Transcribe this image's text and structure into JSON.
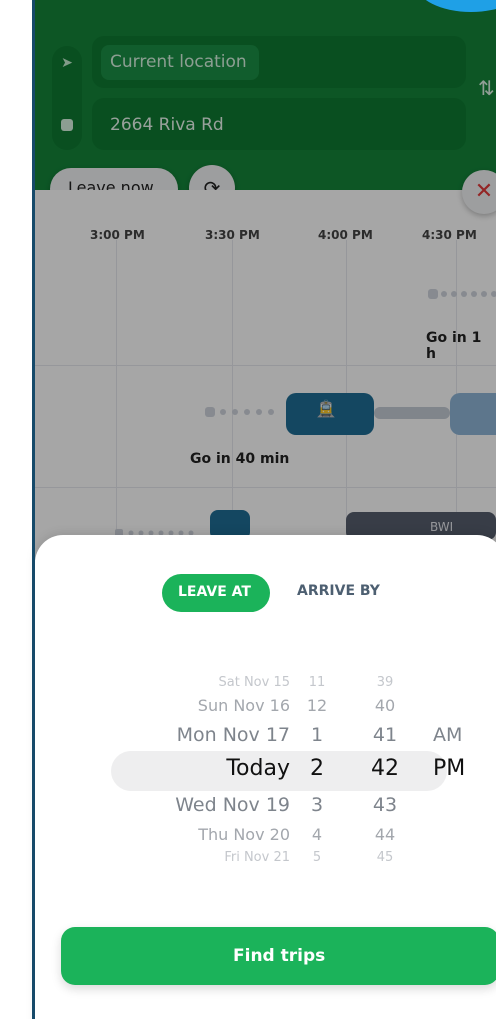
{
  "colors": {
    "header_green": "#14853a",
    "accent_green": "#1bb35a",
    "tram_blue": "#1f6e96",
    "border_navy": "#164a6a"
  },
  "header": {
    "origin_label": "Current location",
    "destination_label": "2664 Riva Rd",
    "location_icon": "navigation-arrow-icon",
    "destination_icon": "stop-square-icon",
    "swap_icon": "swap-icon",
    "leave_now_label": "Leave now",
    "refresh_icon": "refresh-icon",
    "close_icon": "close-icon"
  },
  "timeline": {
    "times": [
      "3:00 PM",
      "3:30 PM",
      "4:00 PM",
      "4:30 PM"
    ],
    "trip1_hint": "Go in 1 h",
    "trip2_hint": "Go in 40 min",
    "tram_icon": "tram-icon",
    "trip3_partial_label": "BWI"
  },
  "sheet": {
    "mode_tabs": [
      "LEAVE AT",
      "ARRIVE BY"
    ],
    "selected_mode": "LEAVE AT",
    "picker": {
      "rows": [
        {
          "date": "Sat Nov 15",
          "hour": "11",
          "minute": "39",
          "ampm": ""
        },
        {
          "date": "Sun Nov 16",
          "hour": "12",
          "minute": "40",
          "ampm": ""
        },
        {
          "date": "Mon Nov 17",
          "hour": "1",
          "minute": "41",
          "ampm": "AM"
        },
        {
          "date": "Today",
          "hour": "2",
          "minute": "42",
          "ampm": "PM"
        },
        {
          "date": "Wed Nov 19",
          "hour": "3",
          "minute": "43",
          "ampm": ""
        },
        {
          "date": "Thu Nov 20",
          "hour": "4",
          "minute": "44",
          "ampm": ""
        },
        {
          "date": "Fri Nov 21",
          "hour": "5",
          "minute": "45",
          "ampm": ""
        }
      ],
      "selected_index": 3
    },
    "find_trips_label": "Find trips"
  }
}
